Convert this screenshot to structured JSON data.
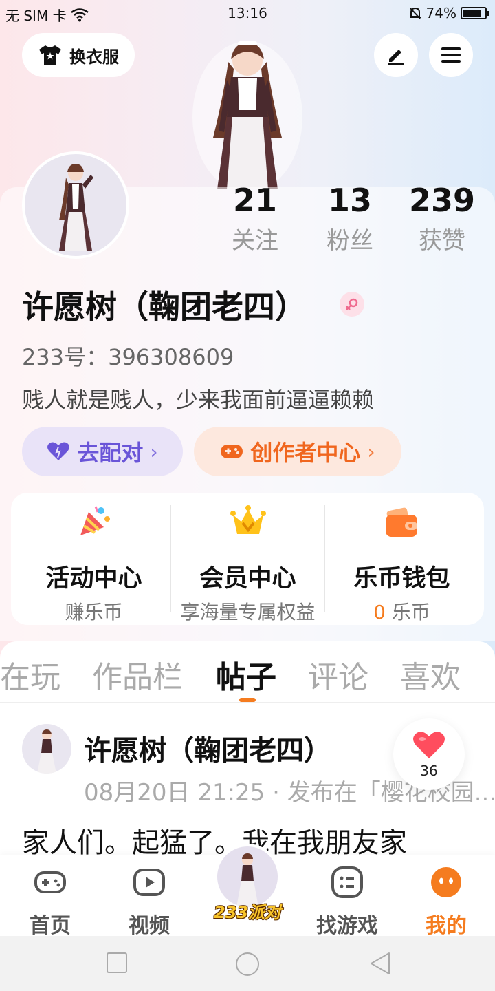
{
  "status_bar": {
    "carrier": "无 SIM 卡",
    "time": "13:16",
    "battery": "74%"
  },
  "header": {
    "outfit_label": "换衣服",
    "edit_icon": "pen-icon",
    "menu_icon": "hamburger-icon"
  },
  "stats": [
    {
      "value": "21",
      "label": "关注"
    },
    {
      "value": "13",
      "label": "粉丝"
    },
    {
      "value": "239",
      "label": "获赞"
    }
  ],
  "profile": {
    "name": "许愿树（鞠团老四）",
    "gender": "female",
    "uid": "233号：396308609",
    "bio": "贱人就是贱人，少来我面前逼逼赖赖"
  },
  "actions": {
    "match_label": "去配对",
    "creator_label": "创作者中心"
  },
  "quick": [
    {
      "title": "活动中心",
      "sub": "赚乐币"
    },
    {
      "title": "会员中心",
      "sub": "享海量专属权益"
    },
    {
      "title": "乐币钱包",
      "sub_num": "0",
      "sub": "乐币"
    }
  ],
  "tabs": [
    "在玩",
    "作品栏",
    "帖子",
    "评论",
    "喜欢"
  ],
  "active_tab": "帖子",
  "post": {
    "author": "许愿树（鞠团老四）",
    "meta": "08月20日 21:25 · 发布在「樱花校园...",
    "text": "家人们。起猛了。我在我朋友家",
    "likes": "36"
  },
  "nav": {
    "home": "首页",
    "video": "视频",
    "center": "233派对",
    "games": "找游戏",
    "mine": "我的"
  },
  "colors": {
    "accent": "#f57c1f",
    "match": "#6a55d8"
  }
}
